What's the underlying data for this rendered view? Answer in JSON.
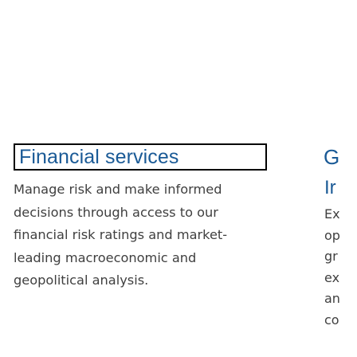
{
  "cards": [
    {
      "title": "Financial services",
      "description_lines": [
        "Manage risk and make informed",
        "decisions through access to our",
        "financial risk ratings and market-",
        "leading macroeconomic and",
        "geopolitical analysis."
      ]
    },
    {
      "title": "G",
      "subtitle": "Ir",
      "description_lines": [
        "Ex",
        "op",
        "gr",
        "ex",
        "an",
        "co"
      ]
    }
  ]
}
